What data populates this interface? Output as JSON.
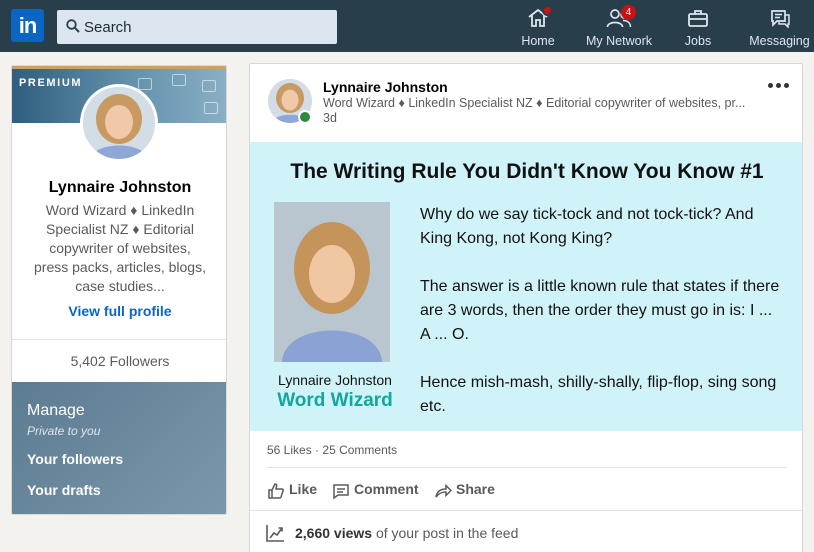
{
  "nav": {
    "logo": "in",
    "search_placeholder": "Search",
    "items": [
      {
        "label": "Home",
        "icon": "home-icon",
        "badge": ""
      },
      {
        "label": "My Network",
        "icon": "network-icon",
        "badge": "4"
      },
      {
        "label": "Jobs",
        "icon": "briefcase-icon",
        "badge": ""
      },
      {
        "label": "Messaging",
        "icon": "messaging-icon",
        "badge": ""
      }
    ]
  },
  "profile": {
    "premium_label": "PREMIUM",
    "name": "Lynnaire Johnston",
    "description": "Word Wizard ♦ LinkedIn Specialist NZ ♦ Editorial copywriter of websites, press packs, articles, blogs, case studies...",
    "view_profile": "View full profile",
    "followers": "5,402 Followers",
    "manage": {
      "title": "Manage",
      "subtitle": "Private to you",
      "links": [
        "Your followers",
        "Your drafts"
      ]
    }
  },
  "post": {
    "author": "Lynnaire Johnston",
    "headline": "Word Wizard ♦ LinkedIn Specialist NZ ♦ Editorial copywriter of websites, pr...",
    "time": "3d",
    "image": {
      "title": "The Writing Rule You Didn't Know You Know #1",
      "caption_name": "Lynnaire Johnston",
      "caption_brand": "Word Wizard",
      "paragraphs": [
        "Why do we say tick-tock and not tock-tick? And King Kong, not Kong King?",
        "The answer is a little known rule that states if there are 3 words, then the order they must go in is: I ... A ... O.",
        "Hence mish-mash, shilly-shally, flip-flop, sing song etc."
      ]
    },
    "likes": "56 Likes",
    "separator": "·",
    "comments": "25 Comments",
    "actions": [
      "Like",
      "Comment",
      "Share"
    ],
    "views_count": "2,660 views",
    "views_suffix": " of your post in the feed"
  },
  "colors": {
    "nav_bg": "#283e4a",
    "brand_blue": "#0a66c2",
    "post_image_bg": "#d0f3fa",
    "brand_teal": "#12a6a0",
    "online_green": "#2e8b3e",
    "badge_red": "#cc1016"
  }
}
